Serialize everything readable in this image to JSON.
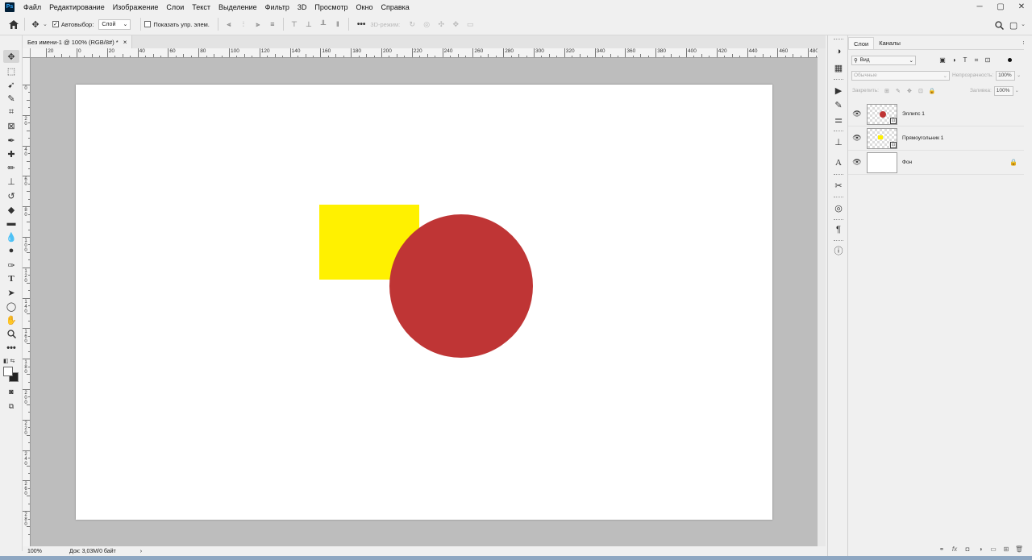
{
  "app": {
    "logo": "Ps"
  },
  "menu": [
    "Файл",
    "Редактирование",
    "Изображение",
    "Слои",
    "Текст",
    "Выделение",
    "Фильтр",
    "3D",
    "Просмотр",
    "Окно",
    "Справка"
  ],
  "window_controls": {
    "minimize": "─",
    "maximize": "▢",
    "close": "✕"
  },
  "options": {
    "auto_select_label": "Автовыбор:",
    "auto_select_checked": true,
    "auto_select_value": "Слой",
    "show_controls_label": "Показать упр. элем.",
    "more_label": "•••",
    "mode_3d_label": "3D-режим:"
  },
  "document": {
    "tab_title": "Без имени-1 @ 100% (RGB/8#) *",
    "tab_close": "×",
    "canvas_color": "#ffffff",
    "rectangle_color": "#fff100",
    "ellipse_color": "#bf3535"
  },
  "ruler": {
    "top_labels": [
      "20",
      "0",
      "20",
      "40",
      "60",
      "80",
      "100",
      "120",
      "140",
      "160",
      "180",
      "200",
      "220",
      "240",
      "260",
      "280",
      "300",
      "320",
      "340",
      "360",
      "380",
      "400",
      "420",
      "440",
      "460",
      "480"
    ],
    "left_labels": [
      "0",
      "2\n0",
      "4\n0",
      "6\n0",
      "8\n0",
      "1\n0\n0",
      "1\n2\n0",
      "1\n4\n0",
      "1\n6\n0",
      "1\n8\n0",
      "2\n0\n0",
      "2\n2\n0",
      "2\n4\n0",
      "2\n6\n0",
      "2\n8\n0"
    ]
  },
  "status": {
    "zoom": "100%",
    "doc_info": "Док: 3,03М/0 байт",
    "arrow": "›"
  },
  "layers_panel": {
    "tabs": [
      "Слои",
      "Каналы"
    ],
    "filter_label": "Вид",
    "blend_mode": "Обычные",
    "opacity_label": "Непрозрачность:",
    "opacity_value": "100%",
    "lock_label": "Закрепить:",
    "fill_label": "Заливка:",
    "fill_value": "100%",
    "layers": [
      {
        "name": "Эллипс 1",
        "thumb_color": "#bf3535"
      },
      {
        "name": "Прямоугольник 1",
        "thumb_color": "#fff100"
      },
      {
        "name": "Фон"
      }
    ]
  },
  "icons": {
    "tools": [
      "move-icon",
      "marquee-icon",
      "lasso-icon",
      "quick-select-icon",
      "crop-icon",
      "frame-icon",
      "eyedropper-icon",
      "healing-icon",
      "brush-icon",
      "stamp-icon",
      "history-brush-icon",
      "eraser-icon",
      "gradient-icon",
      "blur-icon",
      "dodge-icon",
      "pen-icon",
      "type-icon",
      "path-select-icon",
      "ellipse-icon",
      "hand-icon",
      "zoom-icon",
      "more-icon"
    ]
  }
}
